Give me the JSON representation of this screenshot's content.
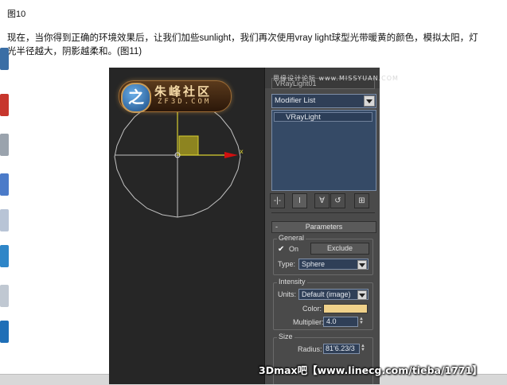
{
  "caption": {
    "figure_label": "图10",
    "paragraph": "现在，当你得到正确的环境效果后，让我们加些sunlight，我们再次使用vray light球型光带暖黄的颜色，模拟太阳，灯光半径越大，阴影越柔和。(图11)"
  },
  "viewport": {
    "logo_cn": "朱峰社区",
    "logo_en": "ZF3D.COM",
    "logo_badge": "之",
    "axis_x_label": "x"
  },
  "command_panel": {
    "top_watermark": "思缘设计论坛 www.MISSYUAN.COM",
    "object_name": "VRayLight01",
    "modifier_list": "Modifier List",
    "stack_item": "VRayLight",
    "tools": [
      "-|-",
      "I",
      "∀",
      "↺",
      "⊞"
    ],
    "rollout_minus": "-",
    "rollout_title": "Parameters",
    "general": {
      "group_label": "General",
      "on_check": "✔",
      "on_label": "On",
      "exclude_button": "Exclude",
      "type_label": "Type:",
      "type_value": "Sphere"
    },
    "intensity": {
      "group_label": "Intensity",
      "units_label": "Units:",
      "units_value": "Default (image)",
      "color_label": "Color:",
      "color_value": "#f0d18a",
      "multiplier_label": "Multiplier:",
      "multiplier_value": "4.0"
    },
    "size": {
      "group_label": "Size",
      "radius_label": "Radius:",
      "radius_value": "81'6.23/3"
    }
  },
  "watermark_bottom": "3Dmax吧【www.linecg.com/tieba/1771】",
  "colors": {
    "viewport_bg": "#262626",
    "panel_bg": "#4a4a4a",
    "field_bg": "#2f3f57",
    "gizmo_yellow": "#c8c020",
    "gizmo_red": "#d01010",
    "light_circle": "#c0c0c0"
  }
}
